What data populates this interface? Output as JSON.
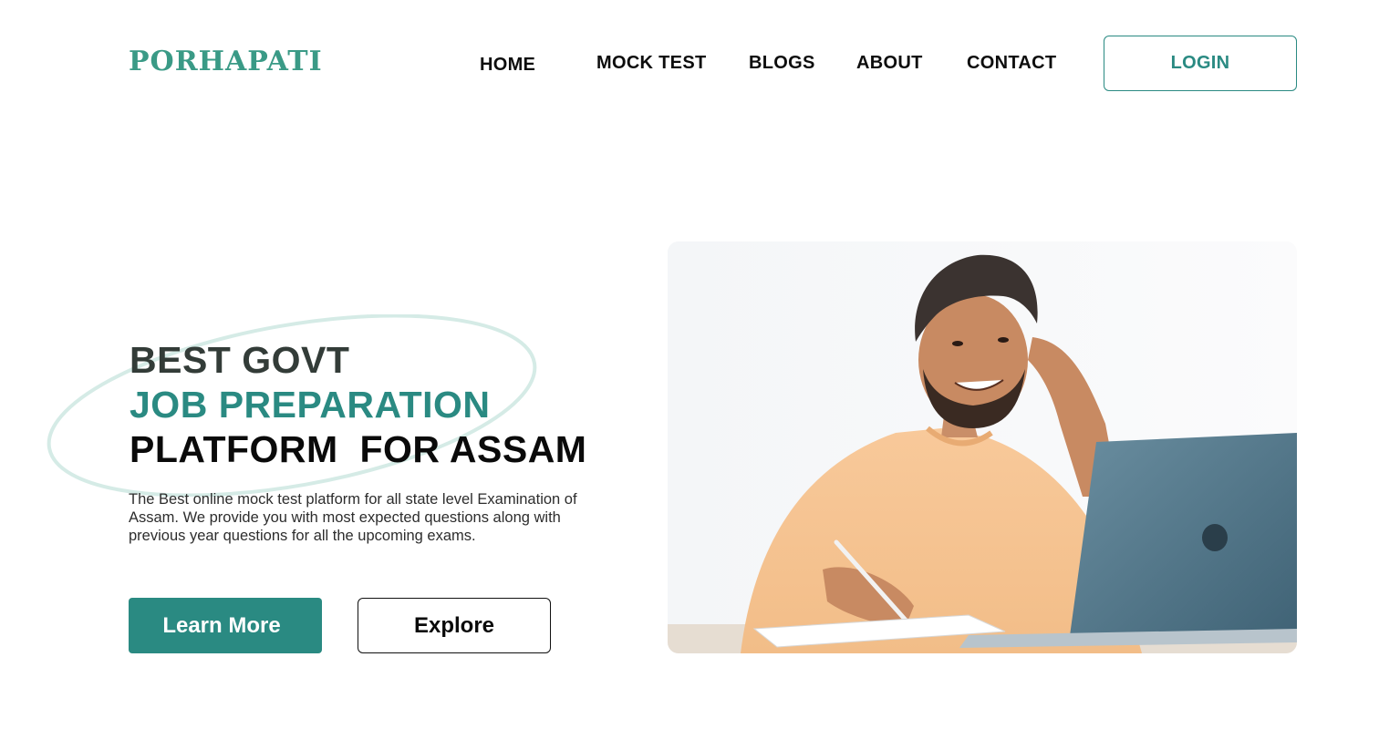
{
  "brand": {
    "logo_text": "PORHAPATI",
    "color": "#3a9a86"
  },
  "nav": {
    "items": [
      {
        "label": "HOME"
      },
      {
        "label": "MOCK TEST"
      },
      {
        "label": "BLOGS"
      },
      {
        "label": "ABOUT"
      },
      {
        "label": "CONTACT"
      }
    ],
    "login_label": "LOGIN"
  },
  "hero": {
    "headline_line1": "BEST GOVT",
    "headline_line2": "JOB PREPARATION",
    "headline_line3": "PLATFORM  FOR ASSAM",
    "description": "The Best online mock test platform for all state level Examination of Assam. We provide you with most expected questions along with previous year questions for all the upcoming exams.",
    "learn_more_label": "Learn More",
    "explore_label": "Explore",
    "image_icon": "student-with-laptop-photo"
  },
  "colors": {
    "accent": "#2a8a82",
    "accent_light": "#d5ebe6",
    "text_dark": "#0a0a0a"
  }
}
